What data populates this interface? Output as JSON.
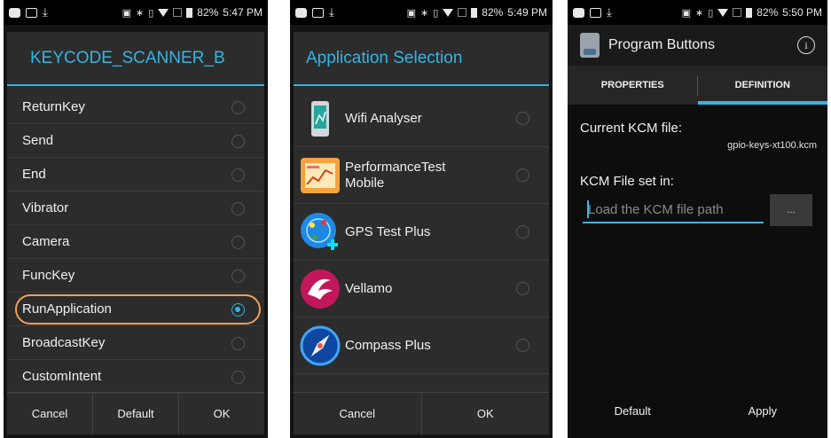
{
  "screens": [
    {
      "status": {
        "battery": "82%",
        "time": "5:47 PM"
      },
      "dialog_title": "KEYCODE_SCANNER_B",
      "options": [
        {
          "label": "ReturnKey",
          "selected": false
        },
        {
          "label": "Send",
          "selected": false
        },
        {
          "label": "End",
          "selected": false
        },
        {
          "label": "Vibrator",
          "selected": false
        },
        {
          "label": "Camera",
          "selected": false
        },
        {
          "label": "FuncKey",
          "selected": false
        },
        {
          "label": "RunApplication",
          "selected": true
        },
        {
          "label": "BroadcastKey",
          "selected": false
        },
        {
          "label": "CustomIntent",
          "selected": false
        }
      ],
      "buttons": {
        "cancel": "Cancel",
        "default": "Default",
        "ok": "OK"
      }
    },
    {
      "status": {
        "battery": "82%",
        "time": "5:49 PM"
      },
      "dialog_title": "Application Selection",
      "apps": [
        {
          "label": "Wifi Analyser",
          "icon": "wifi-analyser-icon"
        },
        {
          "label": "PerformanceTest Mobile",
          "icon": "performancetest-icon"
        },
        {
          "label": "GPS Test Plus",
          "icon": "gps-test-icon"
        },
        {
          "label": "Vellamo",
          "icon": "vellamo-icon"
        },
        {
          "label": "Compass Plus",
          "icon": "compass-icon"
        }
      ],
      "buttons": {
        "cancel": "Cancel",
        "ok": "OK"
      }
    },
    {
      "status": {
        "battery": "82%",
        "time": "5:50 PM"
      },
      "title": "Program Buttons",
      "tabs": [
        "PROPERTIES",
        "DEFINITION"
      ],
      "active_tab": "DEFINITION",
      "current_kcm_label": "Current KCM file:",
      "current_kcm_value": "gpio-keys-xt100.kcm",
      "kcm_set_label": "KCM File set in:",
      "kcm_path_placeholder": "Load the KCM file path",
      "browse_label": "...",
      "buttons": {
        "default": "Default",
        "apply": "Apply"
      }
    }
  ],
  "colors": {
    "accent": "#33b5e5",
    "highlight_ring": "#f0a05a"
  }
}
